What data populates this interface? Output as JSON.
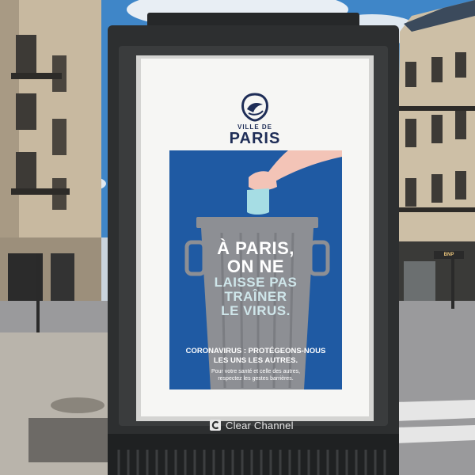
{
  "logo": {
    "small_text": "VILLE DE",
    "big_text": "PARIS",
    "icon": "paris-ship-emblem-icon"
  },
  "headline": {
    "line1": "À PARIS,",
    "line2": "ON NE",
    "line3": "LAISSE PAS",
    "line4": "TRAÎNER",
    "line5": "LE VIRUS."
  },
  "subtext": {
    "main1": "CORONAVIRUS : PROTÉGEONS-NOUS",
    "main2": "LES UNS LES AUTRES.",
    "small1": "Pour votre santé et celle des autres,",
    "small2": "respectez les gestes barrières."
  },
  "branding": {
    "name": "Clear Channel",
    "icon": "clear-channel-logo-icon"
  },
  "street": {
    "store_sign": "BNP PARIBAS"
  },
  "colors": {
    "poster_blue": "#1f5aa3",
    "logo_navy": "#1e2d57",
    "bin_gray": "#8d8f94",
    "headline_light": "#cfe6ea"
  }
}
